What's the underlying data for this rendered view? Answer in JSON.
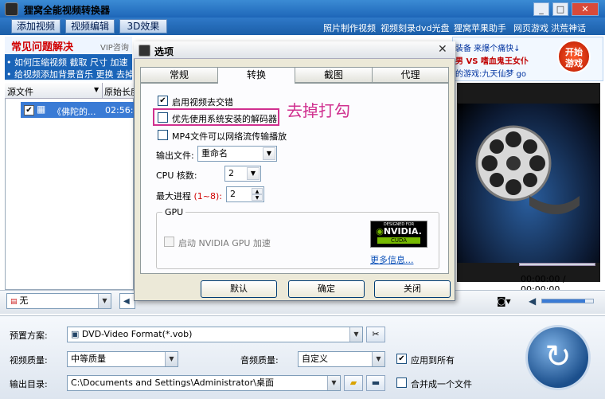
{
  "window": {
    "title": "狸窝全能视频转换器"
  },
  "menubar": {
    "add_video": "添加视频",
    "edit_video": "视频编辑",
    "effect_3d": "3D效果",
    "links": [
      "照片制作视频",
      "视频刻录dvd光盘",
      "狸窝苹果助手",
      "网页游戏",
      "洪荒神话"
    ]
  },
  "banner": {
    "faq_title": "常见问题解决",
    "vip": "VIP咨询",
    "line1": "• 如何压缩视频  截取  尺寸  加速",
    "line2": "• 给视频添加背景音乐  更换  去掉"
  },
  "ad": {
    "line1": "装备  来爆个痛快↓",
    "line2": "男 VS 嗜血鬼王女仆",
    "line3": "的游戏:九天仙梦  go",
    "start": "开始\n游戏"
  },
  "filelist": {
    "col_source": "源文件",
    "col_length": "原始长度",
    "rows": [
      {
        "name": "《佛陀的...",
        "length": "02:56:4"
      }
    ]
  },
  "preview": {
    "time": "00:00:00 / 00:00:00",
    "progress": 0
  },
  "toolbar": {
    "subtitle_value": "无",
    "volume": 0.85
  },
  "bottom": {
    "preset_label": "预置方案:",
    "preset_value": "DVD-Video Format(*.vob)",
    "vquality_label": "视频质量:",
    "vquality_value": "中等质量",
    "aquality_label": "音频质量:",
    "aquality_value": "自定义",
    "apply_all": "应用到所有",
    "output_label": "输出目录:",
    "output_value": "C:\\Documents and Settings\\Administrator\\桌面",
    "merge": "合并成一个文件"
  },
  "dialog": {
    "title": "选项",
    "tabs": [
      "常规",
      "转换",
      "截图",
      "代理"
    ],
    "active_tab": 1,
    "deinterlace": "启用视频去交错",
    "prefer_decoder": "优先使用系统安装的解码器",
    "mp4_stream": "MP4文件可以网络流传输播放",
    "output_file_label": "输出文件:",
    "output_file_value": "重命名",
    "cpu_label": "CPU 核数:",
    "cpu_value": "2",
    "maxproc_label": "最大进程",
    "maxproc_range": "(1~8):",
    "maxproc_value": "2",
    "gpu_group": "GPU",
    "gpu_accel": "启动 NVIDIA GPU 加速",
    "nvidia_top": "DESIGNED FOR",
    "nvidia_brand": "NVIDIA.",
    "nvidia_cuda": "CUDA",
    "more_info": "更多信息...",
    "btn_default": "默认",
    "btn_ok": "确定",
    "btn_close": "关闭",
    "annotation": "去掉打勾"
  },
  "colors": {
    "accent": "#1e66b8",
    "highlight": "#d0308f"
  }
}
